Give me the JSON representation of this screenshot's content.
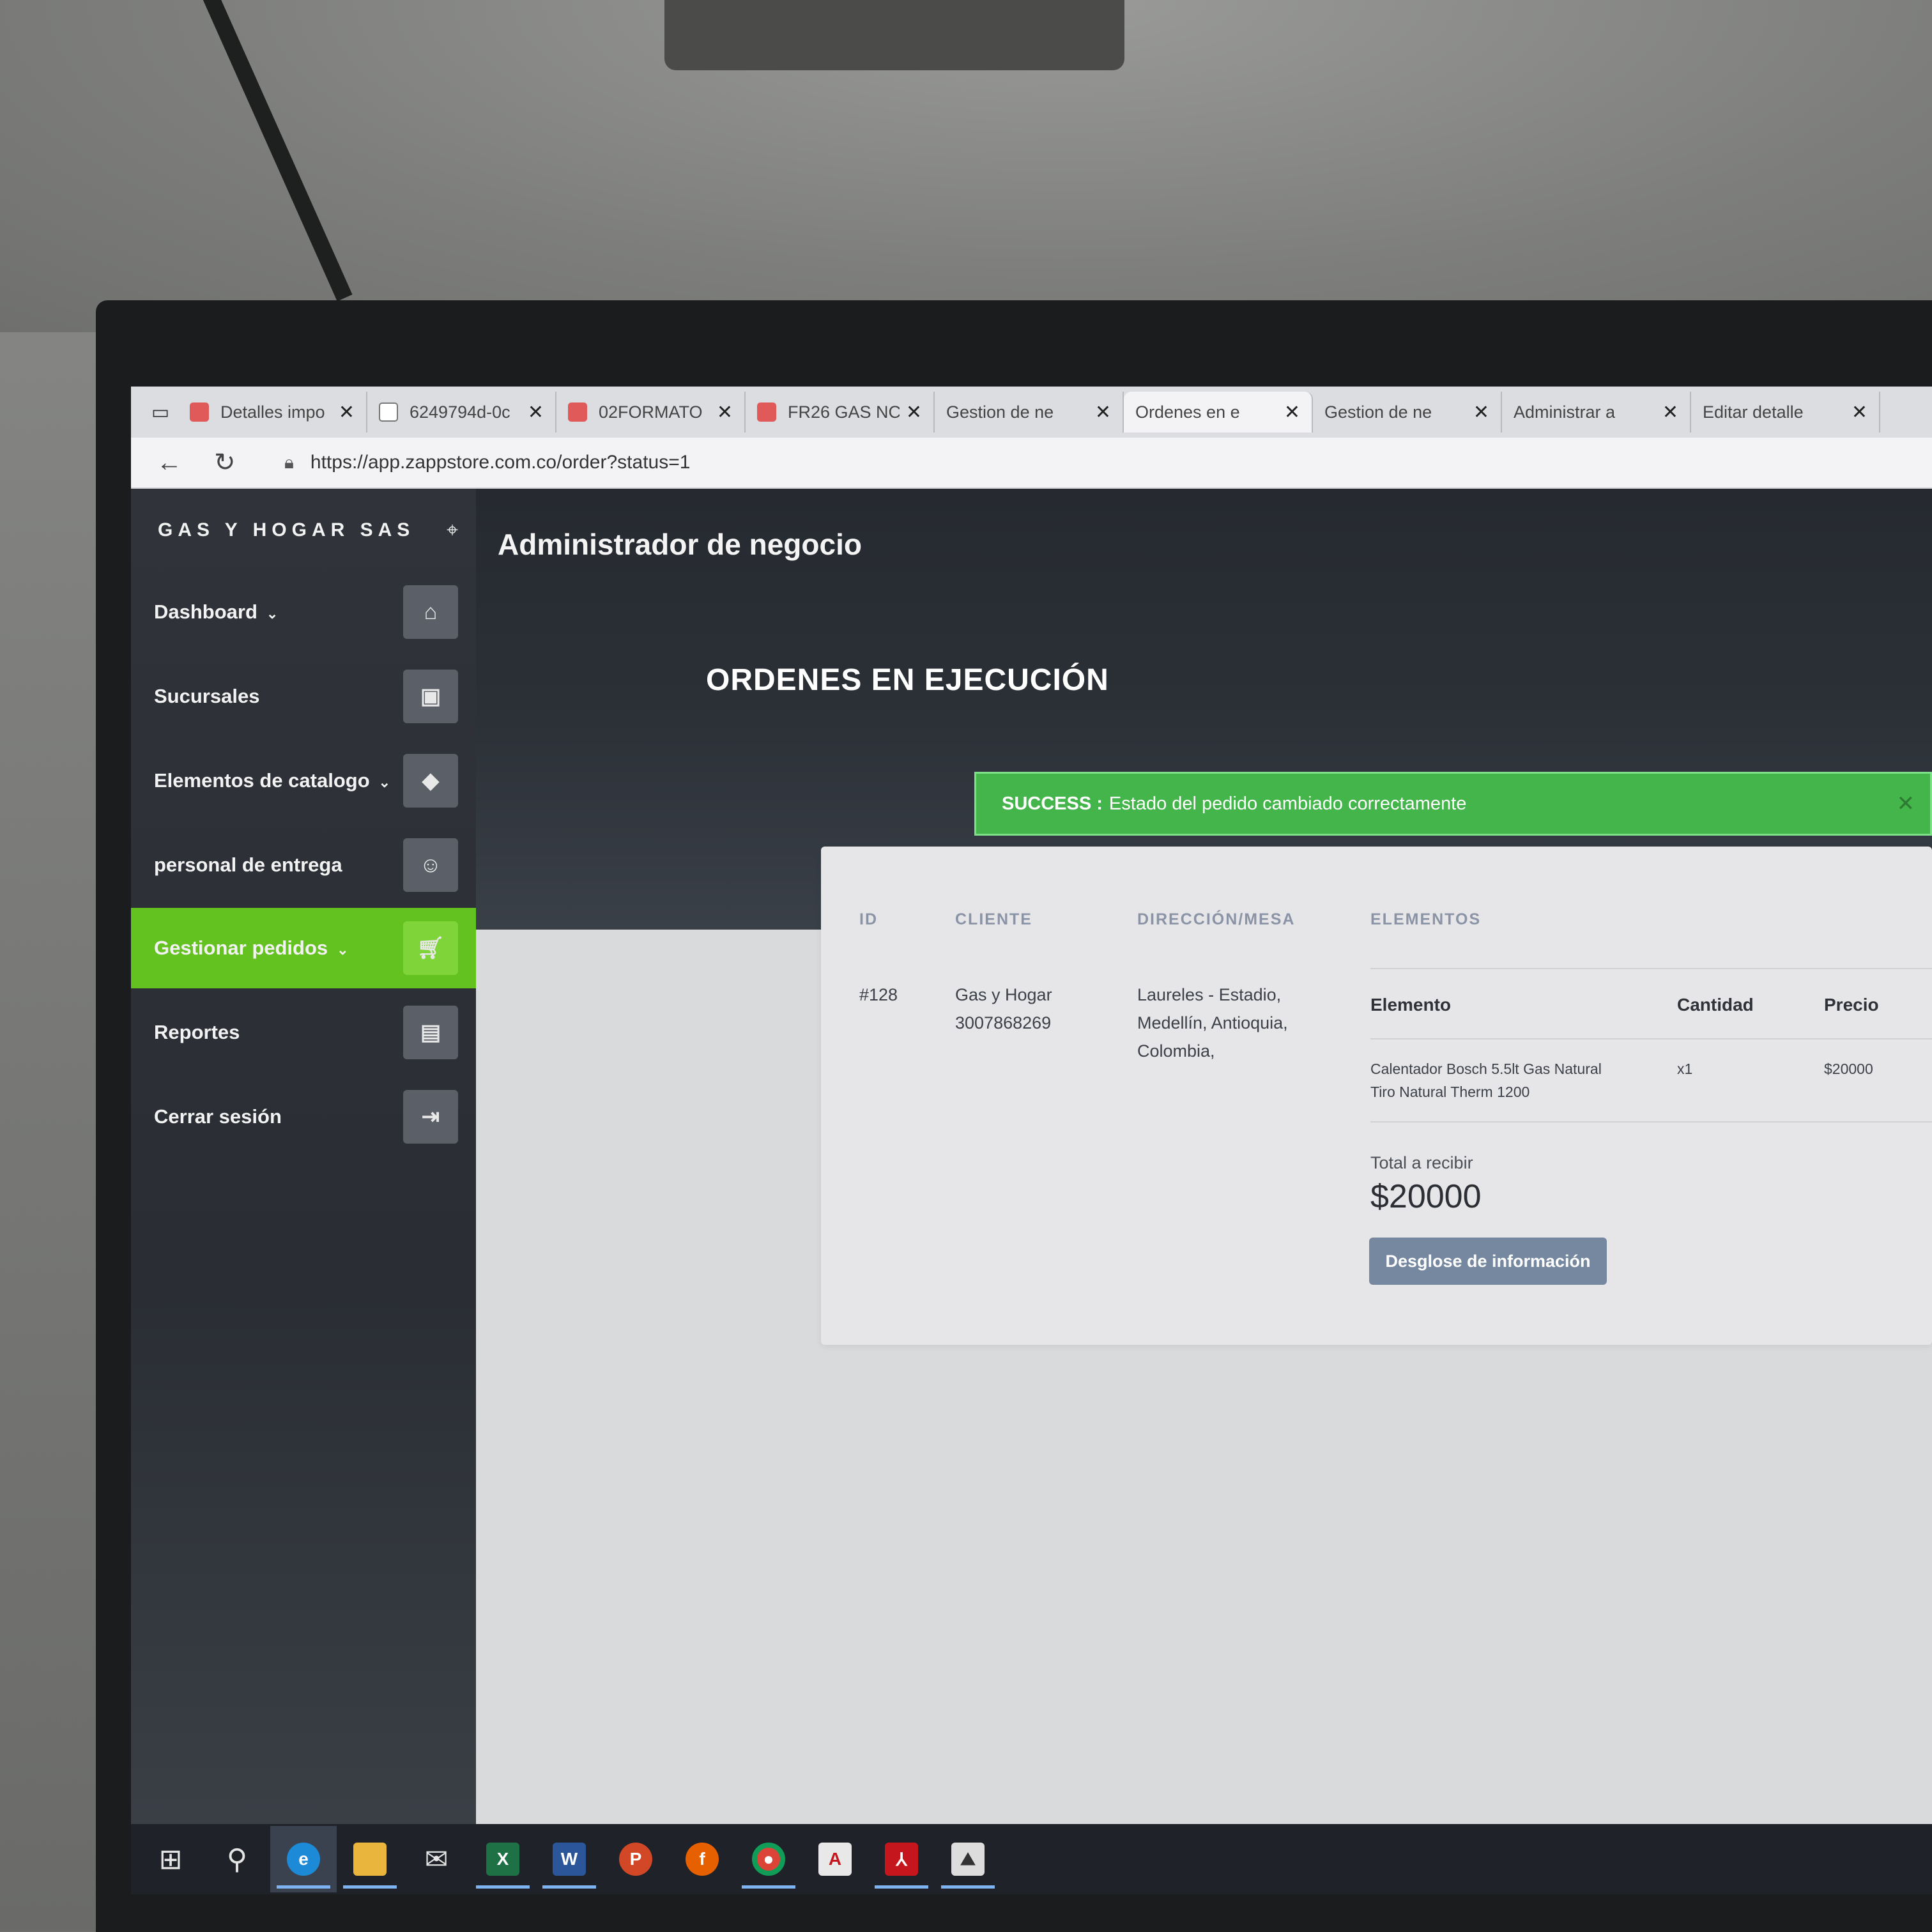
{
  "browser": {
    "tabs": [
      {
        "title": "Detalles impo",
        "icon": "pdf-icon",
        "active": false
      },
      {
        "title": "6249794d-0c",
        "icon": "document-icon",
        "active": false
      },
      {
        "title": "02FORMATO",
        "icon": "pdf-icon",
        "active": false
      },
      {
        "title": "FR26 GAS NC",
        "icon": "pdf-icon",
        "active": false
      },
      {
        "title": "Gestion de ne",
        "icon": "app-icon",
        "active": false
      },
      {
        "title": "Ordenes en e",
        "icon": "app-icon",
        "active": true
      },
      {
        "title": "Gestion de ne",
        "icon": "app-icon",
        "active": false
      },
      {
        "title": "Administrar a",
        "icon": "app-icon",
        "active": false
      },
      {
        "title": "Editar detalle",
        "icon": "app-icon",
        "active": false
      }
    ],
    "url": "https://app.zappstore.com.co/order?status=1"
  },
  "sidebar": {
    "brand": "GAS Y HOGAR SAS",
    "items": [
      {
        "label": "Dashboard",
        "has_chevron": true,
        "icon": "dashboard-icon",
        "active": false
      },
      {
        "label": "Sucursales",
        "has_chevron": false,
        "icon": "store-icon",
        "active": false
      },
      {
        "label": "Elementos de catalogo",
        "has_chevron": true,
        "icon": "tag-icon",
        "active": false
      },
      {
        "label": "personal de entrega",
        "has_chevron": false,
        "icon": "delivery-person-icon",
        "active": false
      },
      {
        "label": "Gestionar pedidos",
        "has_chevron": true,
        "icon": "cart-icon",
        "active": true
      },
      {
        "label": "Reportes",
        "has_chevron": false,
        "icon": "file-icon",
        "active": false
      },
      {
        "label": "Cerrar sesión",
        "has_chevron": false,
        "icon": "logout-icon",
        "active": false
      }
    ]
  },
  "main": {
    "heading": "Administrador de negocio",
    "section_title": "ORDENES EN EJECUCIÓN",
    "alert": {
      "prefix": "SUCCESS :",
      "message": "Estado del pedido cambiado correctamente"
    },
    "table": {
      "columns": [
        "ID",
        "CLIENTE",
        "DIRECCIÓN/MESA",
        "ELEMENTOS"
      ],
      "row": {
        "id": "#128",
        "client_name": "Gas y Hogar",
        "client_phone": "3007868269",
        "address_lines": [
          "Laureles - Estadio,",
          "Medellín, Antioquia,",
          "Colombia,"
        ],
        "elements": {
          "headers": [
            "Elemento",
            "Cantidad",
            "Precio"
          ],
          "items": [
            {
              "name_lines": [
                "Calentador Bosch 5.5lt Gas Natural",
                "Tiro Natural Therm 1200"
              ],
              "qty": "x1",
              "price": "$20000"
            }
          ],
          "total_label": "Total a recibir",
          "total_value": "$20000",
          "detail_button": "Desglose de información"
        }
      }
    }
  },
  "colors": {
    "accent_green": "#63c21f",
    "success": "#43b54a",
    "button": "#7688a0"
  }
}
